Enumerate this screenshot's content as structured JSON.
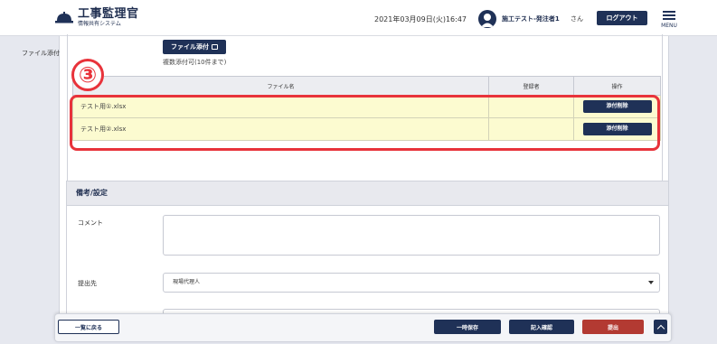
{
  "header": {
    "logo_title": "工事監理官",
    "logo_subtitle": "情報共有システム",
    "datetime": "2021年03月09日(火)16:47",
    "user_name": "施工テスト-発注者1",
    "user_suffix": "さん",
    "logout_label": "ログアウト",
    "menu_label": "MENU"
  },
  "attachment": {
    "label": "ファイル添付",
    "button_label": "ファイル添付",
    "note": "複数添付可(10件まで)"
  },
  "file_table": {
    "columns": [
      "ファイル名",
      "登録者",
      "操作"
    ],
    "rows": [
      {
        "filename": "テスト用①.xlsx",
        "registrant": "",
        "action": "添付削除"
      },
      {
        "filename": "テスト用②.xlsx",
        "registrant": "",
        "action": "添付削除"
      }
    ]
  },
  "annotation": {
    "step_number": "③",
    "color": "#e8333b"
  },
  "notes": {
    "section_title": "備考/設定",
    "comment_label": "コメント",
    "comment_value": "",
    "destination_label": "提出先",
    "destination_value": "現場代理人"
  },
  "actions": {
    "back_label": "一覧に戻る",
    "temp_save_label": "一時保存",
    "confirm_label": "記入確認",
    "submit_label": "提出"
  },
  "colors": {
    "primary": "#1f3157",
    "submit": "#b33a32",
    "highlight_row": "#fcfbd0"
  }
}
